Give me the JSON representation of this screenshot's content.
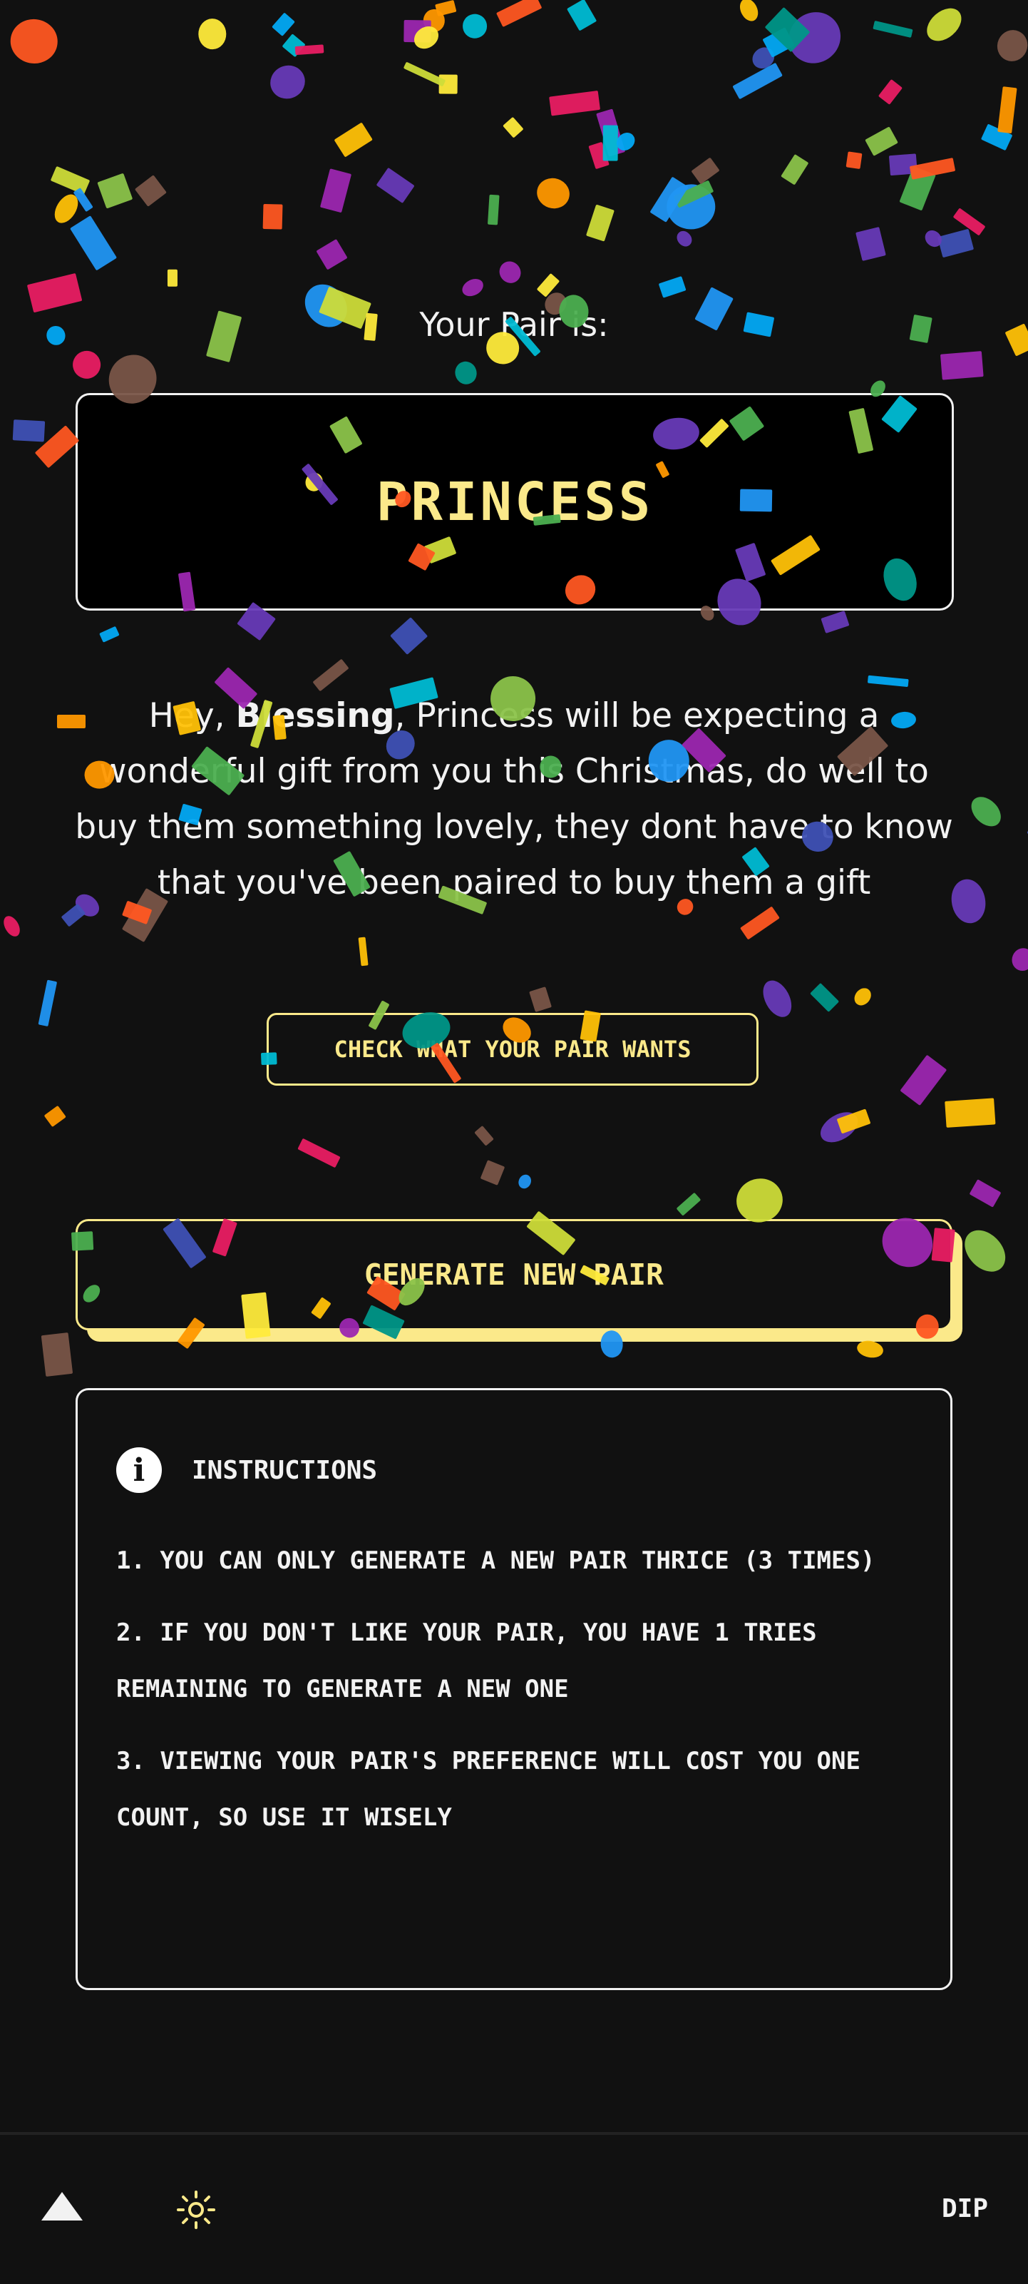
{
  "pair": {
    "label": "Your Pair is:",
    "name": "PRINCESS"
  },
  "message": {
    "greeting": "Hey, ",
    "user": "Blessing",
    "body": ", Princess will be expecting a wonderful gift from you this Christmas, do well to buy them something lovely, they dont have to know that you've been paired to buy them a gift"
  },
  "buttons": {
    "check_wants": "CHECK WHAT YOUR PAIR WANTS",
    "generate": "GENERATE NEW PAIR"
  },
  "instructions": {
    "title": "INSTRUCTIONS",
    "icon": "info-icon",
    "items": [
      "1. YOU CAN ONLY GENERATE A NEW PAIR THRICE (3 TIMES)",
      "2. IF YOU DON'T LIKE YOUR PAIR, YOU HAVE 1 TRIES REMAINING TO GENERATE A NEW ONE",
      "3. VIEWING YOUR PAIR'S PREFERENCE WILL COST YOU ONE COUNT, SO USE IT WISELY"
    ]
  },
  "footer": {
    "home_icon": "triangle-up-icon",
    "theme_icon": "sun-icon",
    "brand": "DIP"
  },
  "colors": {
    "accent": "#fbe98a",
    "background": "#111111",
    "confetti": [
      "#ff5722",
      "#ffeb3b",
      "#03a9f4",
      "#e91e63",
      "#8bc34a",
      "#4caf50",
      "#9c27b0",
      "#ff9800",
      "#009688",
      "#3f51b5",
      "#cddc39",
      "#795548",
      "#00bcd4",
      "#2196f3",
      "#673ab7",
      "#ffc107"
    ]
  }
}
